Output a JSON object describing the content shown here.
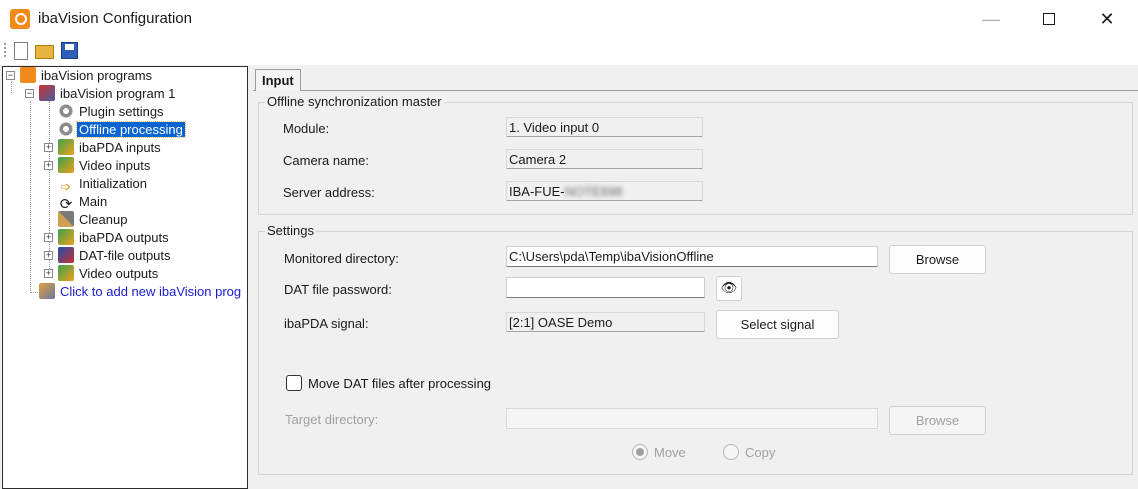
{
  "window": {
    "title": "ibaVision Configuration",
    "minimize": "—",
    "close": "✕"
  },
  "toolbar": {
    "new_icon": "new-file-icon",
    "open_icon": "open-folder-icon",
    "save_icon": "save-icon"
  },
  "tree": {
    "root": "ibaVision programs",
    "program": "ibaVision program 1",
    "items": [
      {
        "label": "Plugin settings",
        "icon": "gear-icon"
      },
      {
        "label": "Offline processing",
        "icon": "gear-icon",
        "selected": true
      },
      {
        "label": "ibaPDA inputs",
        "icon": "pda-input-icon",
        "expandable": true
      },
      {
        "label": "Video inputs",
        "icon": "video-input-icon",
        "expandable": true
      },
      {
        "label": "Initialization",
        "icon": "arrow-icon"
      },
      {
        "label": "Main",
        "icon": "loop-icon"
      },
      {
        "label": "Cleanup",
        "icon": "broom-icon"
      },
      {
        "label": "ibaPDA outputs",
        "icon": "pda-output-icon",
        "expandable": true
      },
      {
        "label": "DAT-file outputs",
        "icon": "dat-output-icon",
        "expandable": true
      },
      {
        "label": "Video outputs",
        "icon": "video-output-icon",
        "expandable": true
      }
    ],
    "add_link": "Click to add new ibaVision prog"
  },
  "tab": {
    "label": "Input"
  },
  "sync_master": {
    "title": "Offline synchronization master",
    "module_label": "Module:",
    "module_value": "1. Video input 0",
    "camera_label": "Camera name:",
    "camera_value": "Camera 2",
    "server_label": "Server address:",
    "server_value_prefix": "IBA-FUE-",
    "server_value_blurred": "NOTE698"
  },
  "settings": {
    "title": "Settings",
    "monitored_label": "Monitored directory:",
    "monitored_value": "C:\\Users\\pda\\Temp\\ibaVisionOffline",
    "browse_label": "Browse",
    "password_label": "DAT file password:",
    "password_value": "",
    "eye_icon": "👁",
    "signal_label": "ibaPDA signal:",
    "signal_value": "[2:1] OASE Demo",
    "select_signal_label": "Select signal",
    "move_files_label": "Move DAT files after processing",
    "move_files_checked": false,
    "target_label": "Target directory:",
    "target_value": "",
    "target_browse_label": "Browse",
    "move_label": "Move",
    "copy_label": "Copy",
    "selected_mode": "Move"
  }
}
